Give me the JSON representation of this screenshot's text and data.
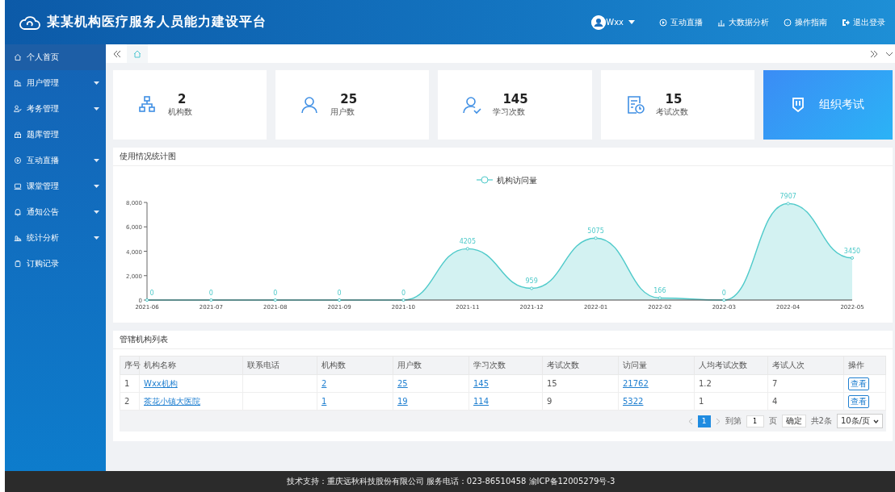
{
  "header": {
    "title": "某某机构医疗服务人员能力建设平台",
    "user": "Wxx",
    "links": [
      {
        "label": "互动直播"
      },
      {
        "label": "大数据分析"
      },
      {
        "label": "操作指南"
      },
      {
        "label": "退出登录"
      }
    ]
  },
  "sidebar": {
    "items": [
      {
        "label": "个人首页",
        "selected": true,
        "has_submenu": false
      },
      {
        "label": "用户管理",
        "selected": false,
        "has_submenu": true
      },
      {
        "label": "考务管理",
        "selected": false,
        "has_submenu": true
      },
      {
        "label": "题库管理",
        "selected": false,
        "has_submenu": false
      },
      {
        "label": "互动直播",
        "selected": false,
        "has_submenu": true
      },
      {
        "label": "课堂管理",
        "selected": false,
        "has_submenu": true
      },
      {
        "label": "通知公告",
        "selected": false,
        "has_submenu": true
      },
      {
        "label": "统计分析",
        "selected": false,
        "has_submenu": true
      },
      {
        "label": "订购记录",
        "selected": false,
        "has_submenu": false
      }
    ]
  },
  "stats": [
    {
      "value": "2",
      "label": "机构数"
    },
    {
      "value": "25",
      "label": "用户数"
    },
    {
      "value": "145",
      "label": "学习次数"
    },
    {
      "value": "15",
      "label": "考试次数"
    }
  ],
  "action_card": {
    "label": "组织考试"
  },
  "chart_panel": {
    "title": "使用情况统计图",
    "chart_data": {
      "type": "area",
      "categories": [
        "2021-06",
        "2021-07",
        "2021-08",
        "2021-09",
        "2021-10",
        "2021-11",
        "2021-12",
        "2022-01",
        "2022-02",
        "2022-03",
        "2022-04",
        "2022-05"
      ],
      "series": [
        {
          "name": "机构访问量",
          "color": "#4fcaca",
          "values": [
            0,
            0,
            0,
            0,
            0,
            4205,
            959,
            5075,
            166,
            0,
            7907,
            3450
          ]
        }
      ],
      "ylim": [
        0,
        8000
      ],
      "yticks": [
        {
          "value": 0,
          "label": "0"
        },
        {
          "value": 2000,
          "label": "2,000"
        },
        {
          "value": 4000,
          "label": "4,000"
        },
        {
          "value": 6000,
          "label": "6,000"
        },
        {
          "value": 8000,
          "label": "8,000"
        }
      ],
      "data_labels": true
    }
  },
  "table_panel": {
    "title": "管辖机构列表",
    "columns": [
      "序号",
      "机构名称",
      "联系电话",
      "机构数",
      "用户数",
      "学习次数",
      "考试次数",
      "访问量",
      "人均考试次数",
      "考试人次",
      "操作"
    ],
    "rows": [
      [
        {
          "kind": "text",
          "text": "1"
        },
        {
          "kind": "link",
          "text": "Wxx机构"
        },
        {
          "kind": "blank"
        },
        {
          "kind": "link",
          "text": "2"
        },
        {
          "kind": "link",
          "text": "25"
        },
        {
          "kind": "link",
          "text": "145"
        },
        {
          "kind": "text",
          "text": "15"
        },
        {
          "kind": "link",
          "text": "21762"
        },
        {
          "kind": "text",
          "text": "1.2"
        },
        {
          "kind": "text",
          "text": "7"
        },
        {
          "kind": "button",
          "text": "查看"
        }
      ],
      [
        {
          "kind": "text",
          "text": "2"
        },
        {
          "kind": "link",
          "text": "茶花小镇大医院"
        },
        {
          "kind": "blank"
        },
        {
          "kind": "link",
          "text": "1"
        },
        {
          "kind": "link",
          "text": "19"
        },
        {
          "kind": "link",
          "text": "114"
        },
        {
          "kind": "text",
          "text": "9"
        },
        {
          "kind": "link",
          "text": "5322"
        },
        {
          "kind": "text",
          "text": "1"
        },
        {
          "kind": "text",
          "text": "4"
        },
        {
          "kind": "button",
          "text": "查看"
        }
      ]
    ],
    "pagination": {
      "pages": [
        {
          "label": "1",
          "selected": true
        }
      ],
      "goto_label": "到第",
      "goto_value": "1",
      "page_unit": "页",
      "confirm": "确定",
      "total": "共2条",
      "page_size": "10条/页"
    }
  },
  "footer": {
    "text": "技术支持：重庆远秋科技股份有限公司 服务电话：023-86510458 渝ICP备12005279号-3"
  }
}
